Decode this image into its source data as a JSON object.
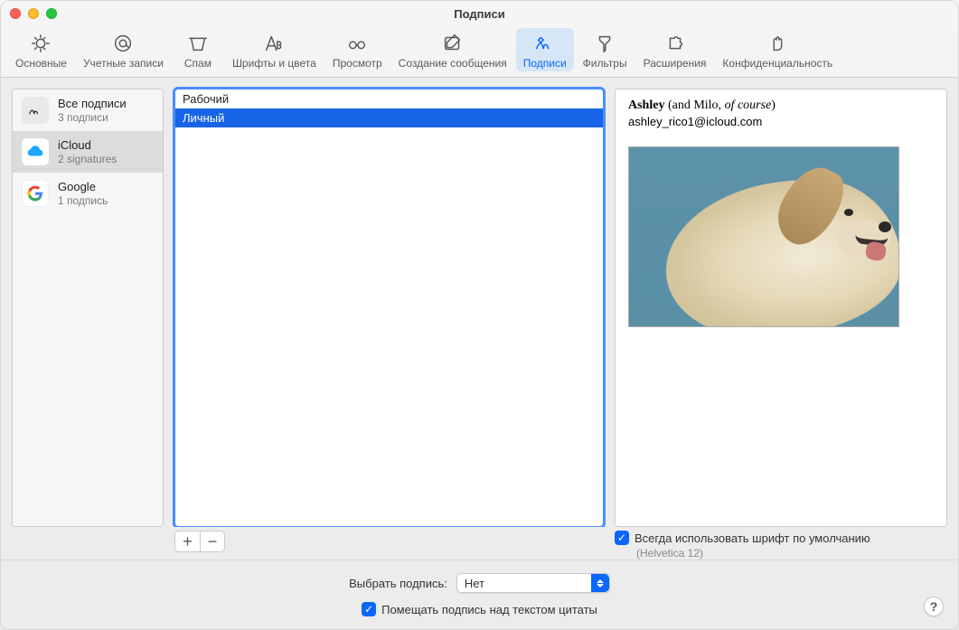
{
  "window": {
    "title": "Подписи"
  },
  "toolbar": {
    "items": [
      {
        "label": "Основные"
      },
      {
        "label": "Учетные записи"
      },
      {
        "label": "Спам"
      },
      {
        "label": "Шрифты и цвета"
      },
      {
        "label": "Просмотр"
      },
      {
        "label": "Создание сообщения"
      },
      {
        "label": "Подписи"
      },
      {
        "label": "Фильтры"
      },
      {
        "label": "Расширения"
      },
      {
        "label": "Конфиденциальность"
      }
    ],
    "active_index": 6
  },
  "accounts": [
    {
      "name": "Все подписи",
      "count": "3 подписи",
      "selected": false
    },
    {
      "name": "iCloud",
      "count": "2 signatures",
      "selected": true
    },
    {
      "name": "Google",
      "count": "1 подпись",
      "selected": false
    }
  ],
  "signatures": [
    {
      "name": "Рабочий",
      "selected": false
    },
    {
      "name": "Личный",
      "selected": true
    }
  ],
  "preview": {
    "name_bold": "Ashley",
    "paren_plain": " (and Milo, ",
    "paren_italic": "of course",
    "paren_close": ")",
    "email": "ashley_rico1@icloud.com"
  },
  "buttons": {
    "plus": "+",
    "minus": "−"
  },
  "defaults_check": {
    "label": "Всегда использовать шрифт по умолчанию",
    "font": "(Helvetica 12)",
    "checked": true
  },
  "footer": {
    "choose_label": "Выбрать подпись:",
    "choose_value": "Нет",
    "above_label": "Помещать подпись над текстом цитаты",
    "above_checked": true,
    "help": "?"
  }
}
